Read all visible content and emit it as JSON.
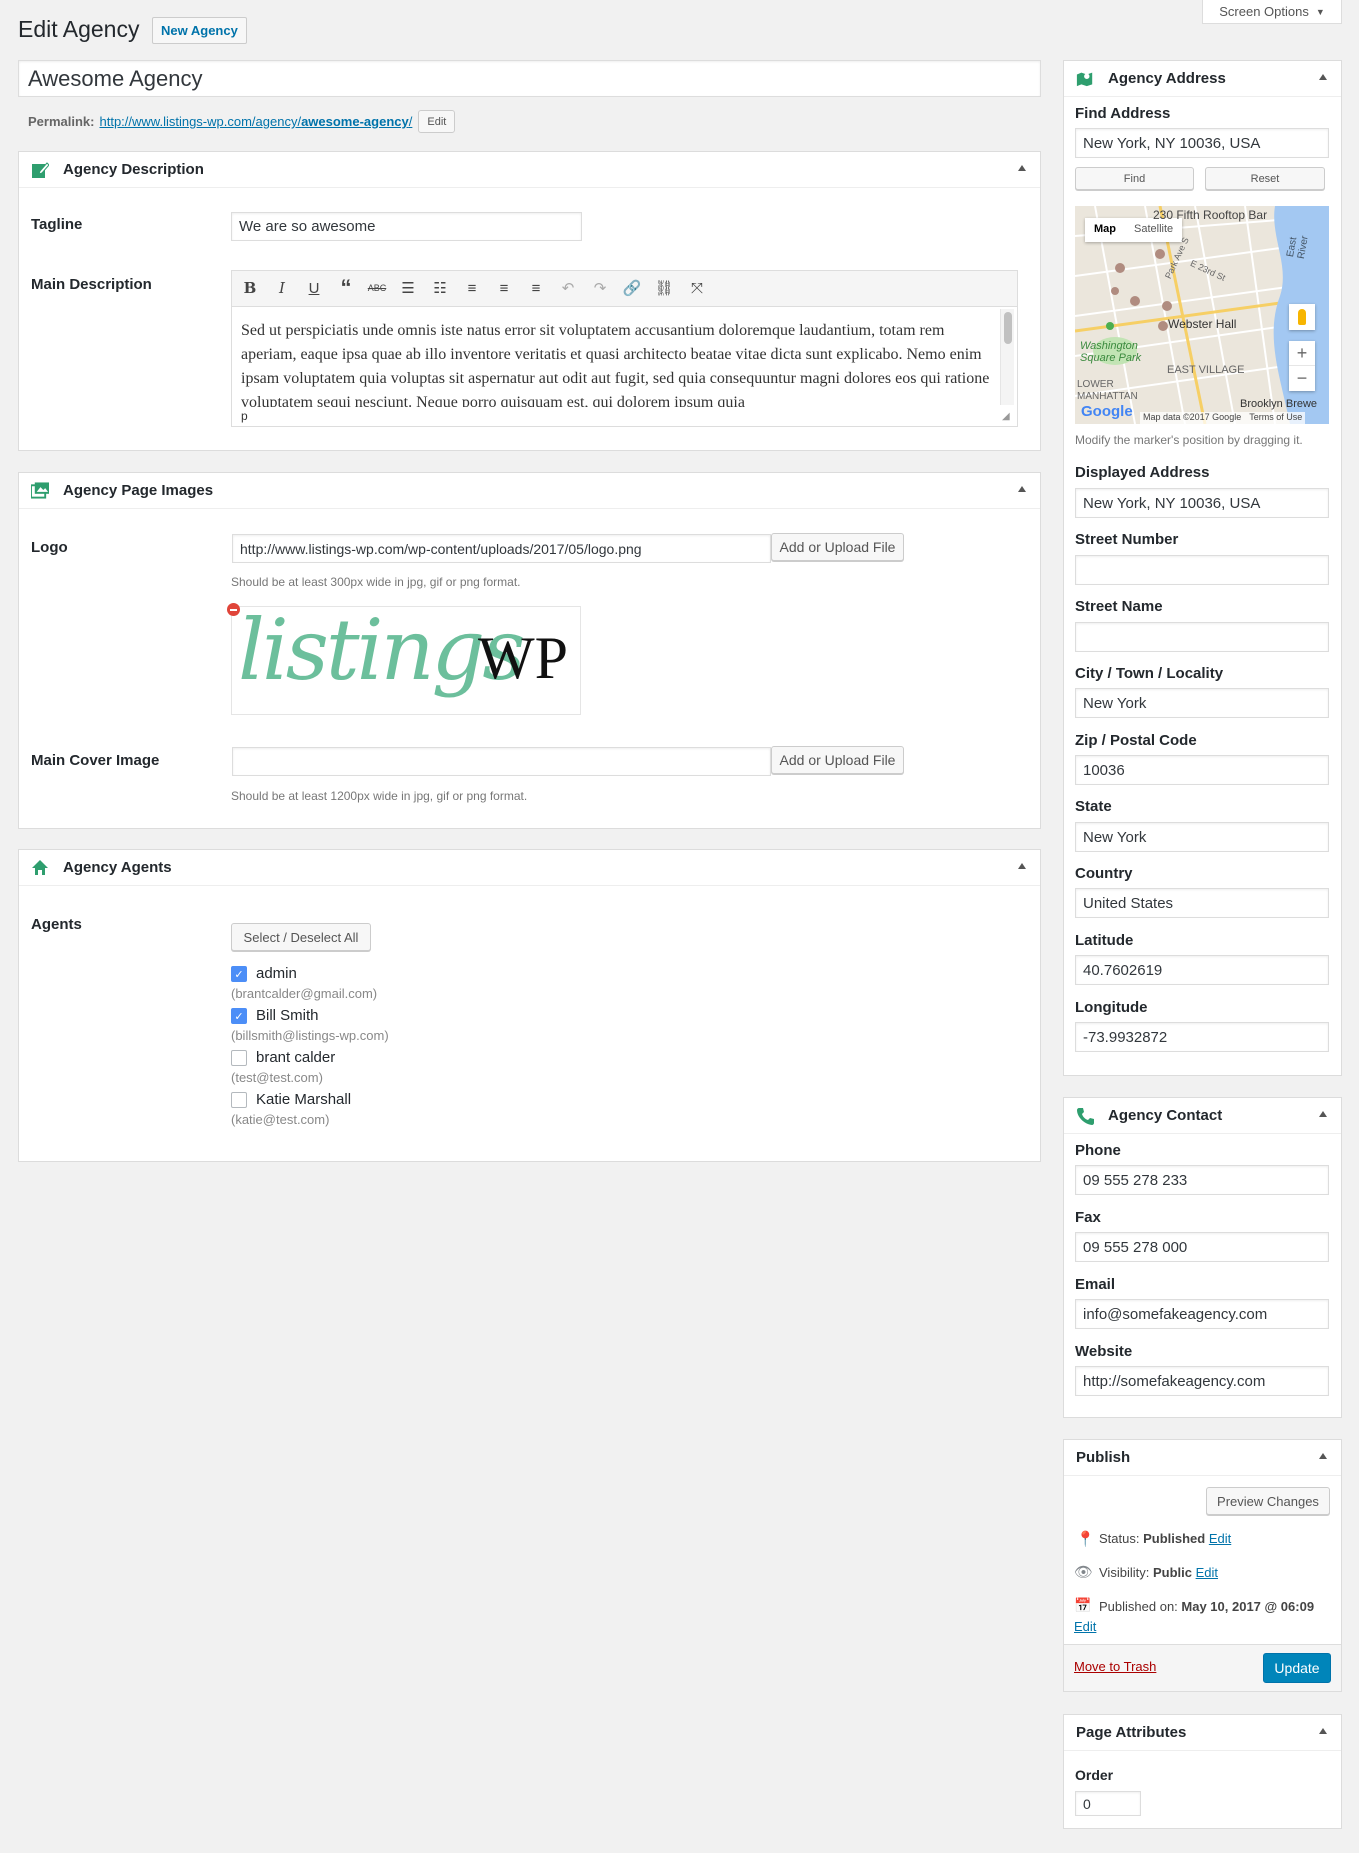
{
  "page": {
    "title": "Edit Agency",
    "new_button": "New Agency",
    "screen_options": "Screen Options"
  },
  "post": {
    "title": "Awesome Agency",
    "permalink_label": "Permalink:",
    "permalink_base": "http://www.listings-wp.com/agency/",
    "permalink_slug": "awesome-agency",
    "permalink_end": "/",
    "permalink_edit": "Edit"
  },
  "description_box": {
    "title": "Agency Description",
    "tagline_label": "Tagline",
    "tagline_value": "We are so awesome",
    "main_label": "Main Description",
    "main_text": "Sed ut perspiciatis unde omnis iste natus error sit voluptatem accusantium doloremque laudantium, totam rem aperiam, eaque ipsa quae ab illo inventore veritatis et quasi architecto beatae vitae dicta sunt explicabo. Nemo enim ipsam voluptatem quia voluptas sit aspernatur aut odit aut fugit, sed quia consequuntur magni dolores eos qui ratione voluptatem sequi nesciunt. Neque porro quisquam est, qui dolorem ipsum quia",
    "path": "p"
  },
  "images_box": {
    "title": "Agency Page Images",
    "logo_label": "Logo",
    "logo_url": "http://www.listings-wp.com/wp-content/uploads/2017/05/logo.png",
    "upload_button": "Add or Upload File",
    "logo_hint": "Should be at least 300px wide in jpg, gif or png format.",
    "logo_text_a": "listings",
    "logo_text_b": "WP",
    "cover_label": "Main Cover Image",
    "cover_url": "",
    "cover_hint": "Should be at least 1200px wide in jpg, gif or png format."
  },
  "agents_box": {
    "title": "Agency Agents",
    "label": "Agents",
    "select_all": "Select / Deselect All",
    "agents": [
      {
        "name": "admin",
        "email": "(brantcalder@gmail.com)",
        "checked": true
      },
      {
        "name": "Bill Smith",
        "email": "(billsmith@listings-wp.com)",
        "checked": true
      },
      {
        "name": "brant calder",
        "email": "(test@test.com)",
        "checked": false
      },
      {
        "name": "Katie Marshall",
        "email": "(katie@test.com)",
        "checked": false
      }
    ]
  },
  "address_box": {
    "title": "Agency Address",
    "find_label": "Find Address",
    "find_value": "New York, NY 10036, USA",
    "find_button": "Find",
    "reset_button": "Reset",
    "map": {
      "tab_map": "Map",
      "tab_satellite": "Satellite",
      "labels": [
        "230 Fifth Rooftop Bar",
        "Webster Hall",
        "Washington Square Park",
        "EAST VILLAGE",
        "LOWER MANHATTAN",
        "Brooklyn Brewe",
        "East River",
        "Park Ave S",
        "E 23rd St"
      ],
      "attribution": "Map data ©2017 Google",
      "terms": "Terms of Use",
      "google": "Google"
    },
    "map_hint": "Modify the marker's position by dragging it.",
    "fields": [
      {
        "label": "Displayed Address",
        "value": "New York, NY 10036, USA"
      },
      {
        "label": "Street Number",
        "value": ""
      },
      {
        "label": "Street Name",
        "value": ""
      },
      {
        "label": "City / Town / Locality",
        "value": "New York"
      },
      {
        "label": "Zip / Postal Code",
        "value": "10036"
      },
      {
        "label": "State",
        "value": "New York"
      },
      {
        "label": "Country",
        "value": "United States"
      },
      {
        "label": "Latitude",
        "value": "40.7602619"
      },
      {
        "label": "Longitude",
        "value": "-73.9932872"
      }
    ]
  },
  "contact_box": {
    "title": "Agency Contact",
    "fields": [
      {
        "label": "Phone",
        "value": "09 555 278 233"
      },
      {
        "label": "Fax",
        "value": "09 555 278 000"
      },
      {
        "label": "Email",
        "value": "info@somefakeagency.com"
      },
      {
        "label": "Website",
        "value": "http://somefakeagency.com"
      }
    ]
  },
  "publish_box": {
    "title": "Publish",
    "preview": "Preview Changes",
    "status_label": "Status:",
    "status_value": "Published",
    "visibility_label": "Visibility:",
    "visibility_value": "Public",
    "published_label": "Published on:",
    "published_value": "May 10, 2017 @ 06:09",
    "edit": "Edit",
    "trash": "Move to Trash",
    "update": "Update"
  },
  "attributes_box": {
    "title": "Page Attributes",
    "order_label": "Order",
    "order_value": "0"
  },
  "colors": {
    "accent": "#0073aa",
    "update_button": "#0085ba",
    "icon_green": "#2e9e6e",
    "logo_green": "#6cbf9c",
    "trash_red": "#a00"
  }
}
